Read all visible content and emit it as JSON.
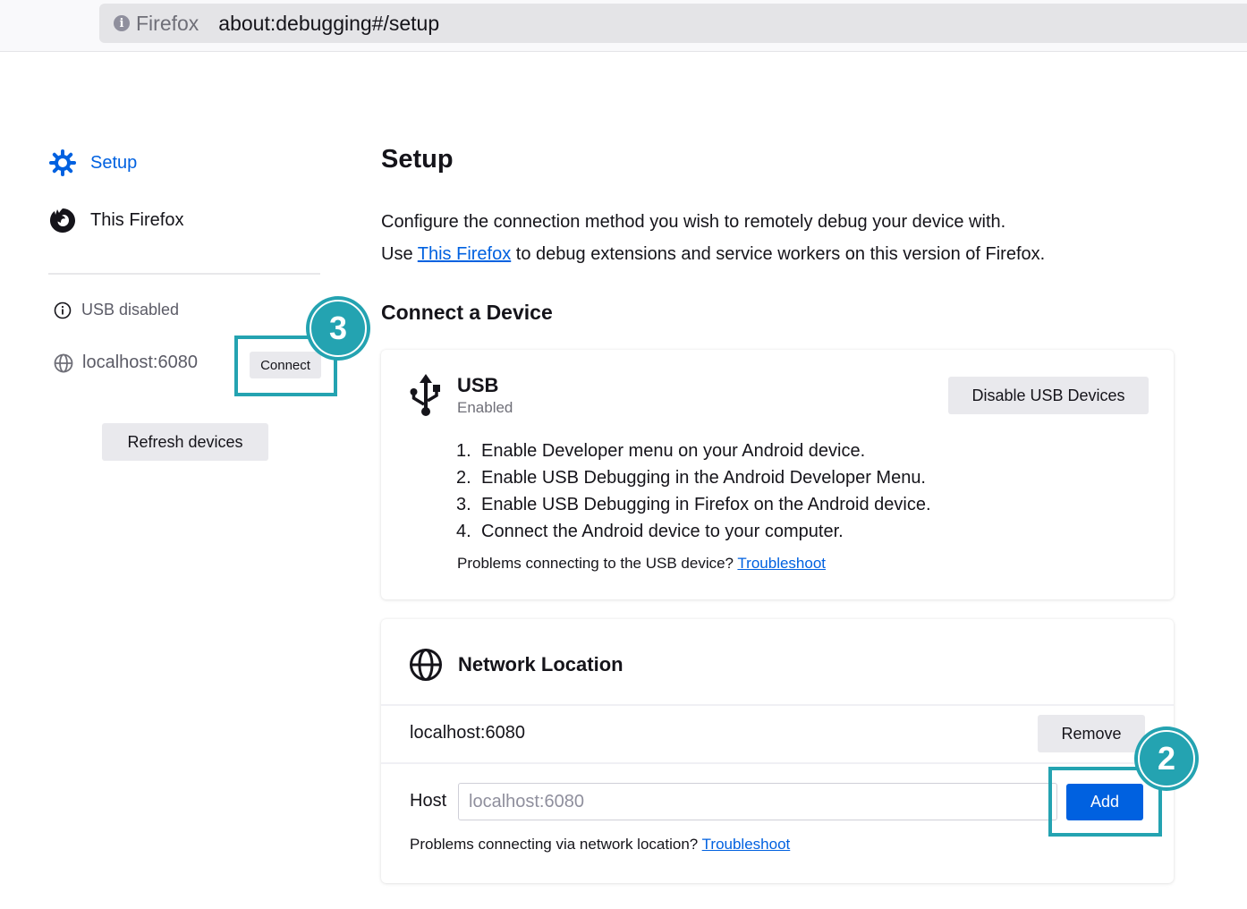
{
  "browser": {
    "identity_label": "Firefox",
    "url": "about:debugging#/setup"
  },
  "sidebar": {
    "nav": [
      {
        "label": "Setup",
        "icon": "gear-icon",
        "selected": true
      },
      {
        "label": "This Firefox",
        "icon": "firefox-icon",
        "selected": false
      }
    ],
    "usb_status": "USB disabled",
    "device": {
      "label": "localhost:6080",
      "connect_label": "Connect"
    },
    "refresh_label": "Refresh devices"
  },
  "main": {
    "title": "Setup",
    "intro_line1": "Configure the connection method you wish to remotely debug your device with.",
    "intro_line2_prefix": "Use ",
    "intro_line2_link": "This Firefox",
    "intro_line2_suffix": " to debug extensions and service workers on this version of Firefox.",
    "section_title": "Connect a Device",
    "usb": {
      "title": "USB",
      "status": "Enabled",
      "disable_label": "Disable USB Devices",
      "steps": [
        {
          "num": "1.",
          "text": "Enable Developer menu on your Android device."
        },
        {
          "num": "2.",
          "text": "Enable USB Debugging in the Android Developer Menu."
        },
        {
          "num": "3.",
          "text": "Enable USB Debugging in Firefox on the Android device."
        },
        {
          "num": "4.",
          "text": "Connect the Android device to your computer."
        }
      ],
      "help_text": "Problems connecting to the USB device? ",
      "help_link": "Troubleshoot"
    },
    "network": {
      "title": "Network Location",
      "entry": "localhost:6080",
      "remove_label": "Remove",
      "host_label": "Host",
      "host_placeholder": "localhost:6080",
      "host_value": "",
      "add_label": "Add",
      "help_text": "Problems connecting via network location? ",
      "help_link": "Troubleshoot"
    }
  },
  "annotations": [
    {
      "number": "2",
      "target": "add-button"
    },
    {
      "number": "3",
      "target": "connect-button"
    }
  ],
  "colors": {
    "accent": "#0061e0",
    "callout": "#24a3b1"
  }
}
